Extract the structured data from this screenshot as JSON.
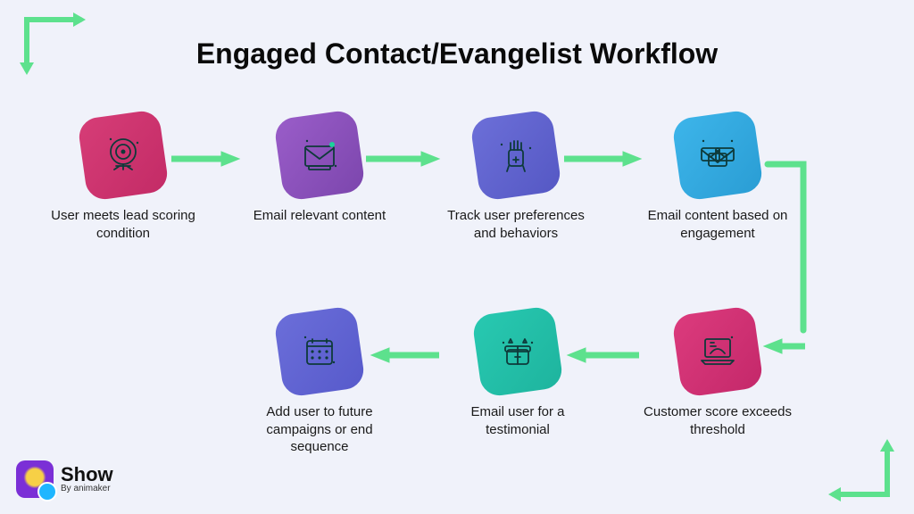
{
  "title": "Engaged Contact/Evangelist Workflow",
  "steps": [
    {
      "label": "User meets lead scoring condition",
      "icon": "target-icon",
      "color": "c-pink"
    },
    {
      "label": "Email relevant content",
      "icon": "envelope-icon",
      "color": "c-purple"
    },
    {
      "label": "Track user preferences and behaviors",
      "icon": "robot-icon",
      "color": "c-indigo"
    },
    {
      "label": "Email content based on engagement",
      "icon": "envelopes-icon",
      "color": "c-blue"
    },
    {
      "label": "Customer score exceeds threshold",
      "icon": "laptop-icon",
      "color": "c-rose"
    },
    {
      "label": "Email user for a testimonial",
      "icon": "gift-icon",
      "color": "c-teal"
    },
    {
      "label": "Add user to future campaigns or end sequence",
      "icon": "calendar-icon",
      "color": "c-violet"
    }
  ],
  "brand": {
    "name": "Show",
    "byline": "By animaker"
  },
  "colors": {
    "accent_arrow": "#5de18d",
    "bg": "#f0f2fa"
  }
}
